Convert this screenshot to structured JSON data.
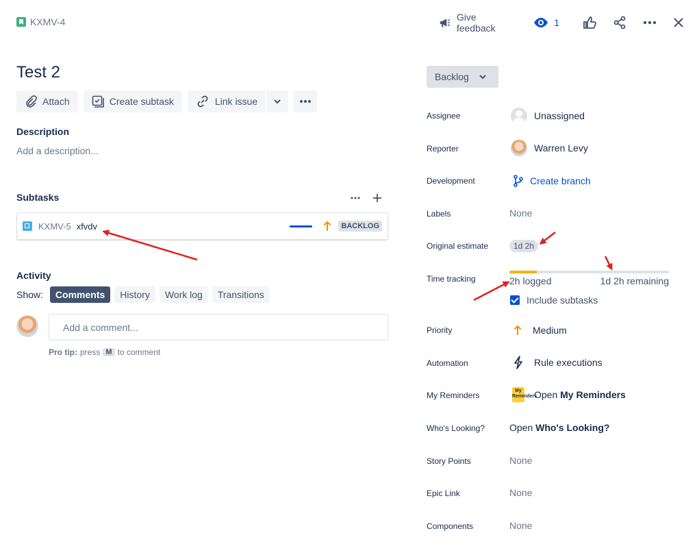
{
  "issue": {
    "key": "KXMV-4",
    "title": "Test 2"
  },
  "header": {
    "feedback_label": "Give feedback",
    "watch_count": "1"
  },
  "actions": {
    "attach": "Attach",
    "create_subtask": "Create subtask",
    "link_issue": "Link issue"
  },
  "description": {
    "label": "Description",
    "placeholder": "Add a description..."
  },
  "subtasks": {
    "label": "Subtasks",
    "items": [
      {
        "key": "KXMV-5",
        "summary": "xfvdv",
        "status": "BACKLOG"
      }
    ]
  },
  "activity": {
    "label": "Activity",
    "show_label": "Show:",
    "tabs": [
      "Comments",
      "History",
      "Work log",
      "Transitions"
    ],
    "active_tab": "Comments",
    "comment_placeholder": "Add a comment...",
    "protip_prefix": "Pro tip:",
    "protip_press": "press",
    "protip_key": "M",
    "protip_suffix": "to comment"
  },
  "status": {
    "label": "Backlog"
  },
  "fields": {
    "assignee": {
      "label": "Assignee",
      "value": "Unassigned"
    },
    "reporter": {
      "label": "Reporter",
      "value": "Warren Levy"
    },
    "development": {
      "label": "Development",
      "value": "Create branch"
    },
    "labels": {
      "label": "Labels",
      "value": "None"
    },
    "original_estimate": {
      "label": "Original estimate",
      "value": "1d 2h"
    },
    "time_tracking": {
      "label": "Time tracking",
      "logged": "2h logged",
      "remaining": "1d 2h remaining",
      "logged_fraction": 0.17,
      "include_subtasks": "Include subtasks"
    },
    "priority": {
      "label": "Priority",
      "value": "Medium"
    },
    "automation": {
      "label": "Automation",
      "value": "Rule executions"
    },
    "my_reminders": {
      "label": "My Reminders",
      "value_prefix": "Open",
      "value_bold": "My Reminders",
      "icon_text": "My Reminders"
    },
    "whos_looking": {
      "label": "Who's Looking?",
      "value_prefix": "Open",
      "value_bold": "Who's Looking?"
    },
    "story_points": {
      "label": "Story Points",
      "value": "None"
    },
    "epic_link": {
      "label": "Epic Link",
      "value": "None"
    },
    "components": {
      "label": "Components",
      "value": "None"
    }
  },
  "colors": {
    "accent": "#0052cc",
    "priority_medium": "#ff8b00",
    "annotation_arrow": "#e02020",
    "time_logged": "#f6b000"
  }
}
